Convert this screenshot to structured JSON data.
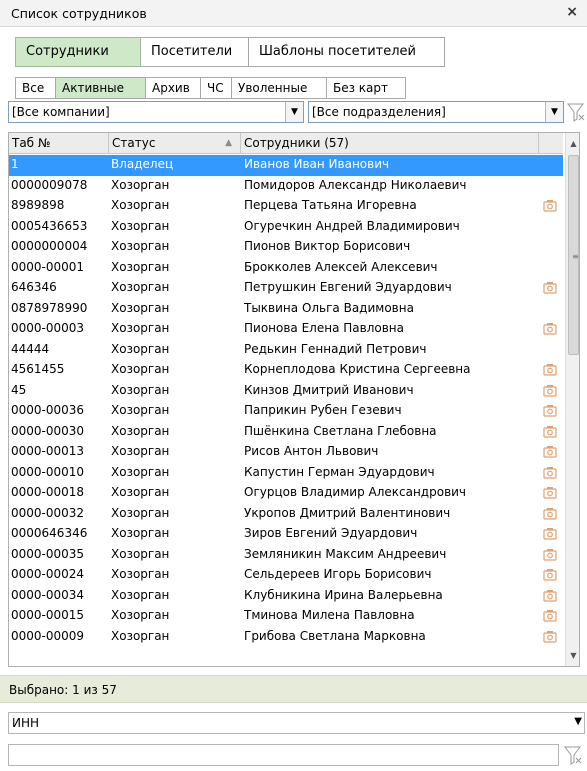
{
  "window": {
    "title": "Список сотрудников",
    "close": "×"
  },
  "tabs_main": [
    {
      "label": "Сотрудники",
      "active": true
    },
    {
      "label": "Посетители",
      "active": false
    },
    {
      "label": "Шаблоны посетителей",
      "active": false
    }
  ],
  "tabs_filter": [
    {
      "label": "Все",
      "active": false
    },
    {
      "label": "Активные",
      "active": true
    },
    {
      "label": "Архив",
      "active": false
    },
    {
      "label": "ЧС",
      "active": false
    },
    {
      "label": "Уволенные",
      "active": false
    },
    {
      "label": "Без карт",
      "active": false
    }
  ],
  "filters": {
    "company": "[Все компании]",
    "department": "[Все подразделения]"
  },
  "grid": {
    "headers": {
      "tab": "Таб №",
      "status": "Статус",
      "employees": "Сотрудники (57)"
    },
    "rows": [
      {
        "tab": "1",
        "status": "Владелец",
        "name": "Иванов Иван Иванович",
        "photo": false,
        "selected": true
      },
      {
        "tab": "0000009078",
        "status": "Хозорган",
        "name": "Помидоров Александр Николаевич",
        "photo": false,
        "selected": false
      },
      {
        "tab": "8989898",
        "status": "Хозорган",
        "name": "Перцева Татьяна Игоревна",
        "photo": true,
        "selected": false
      },
      {
        "tab": "0005436653",
        "status": "Хозорган",
        "name": "Огуречкин Андрей Владимирович",
        "photo": false,
        "selected": false
      },
      {
        "tab": "0000000004",
        "status": "Хозорган",
        "name": "Пионов Виктор Борисович",
        "photo": false,
        "selected": false
      },
      {
        "tab": "0000-00001",
        "status": "Хозорган",
        "name": "Брокколев Алексей Алексевич",
        "photo": false,
        "selected": false
      },
      {
        "tab": "646346",
        "status": "Хозорган",
        "name": "Петрушкин Евгений Эдуардович",
        "photo": true,
        "selected": false
      },
      {
        "tab": "0878978990",
        "status": "Хозорган",
        "name": "Тыквина Ольга Вадимовна",
        "photo": false,
        "selected": false
      },
      {
        "tab": "0000-00003",
        "status": "Хозорган",
        "name": "Пионова Елена Павловна",
        "photo": true,
        "selected": false
      },
      {
        "tab": "44444",
        "status": "Хозорган",
        "name": "Редькин Геннадий Петрович",
        "photo": false,
        "selected": false
      },
      {
        "tab": "4561455",
        "status": "Хозорган",
        "name": "Корнеплодова Кристина Сергеевна",
        "photo": true,
        "selected": false
      },
      {
        "tab": "45",
        "status": "Хозорган",
        "name": "Кинзов Дмитрий Иванович",
        "photo": true,
        "selected": false
      },
      {
        "tab": "0000-00036",
        "status": "Хозорган",
        "name": "Паприкин Рубен Гезевич",
        "photo": true,
        "selected": false
      },
      {
        "tab": "0000-00030",
        "status": "Хозорган",
        "name": "Пшёнкина Светлана Глебовна",
        "photo": true,
        "selected": false
      },
      {
        "tab": "0000-00013",
        "status": "Хозорган",
        "name": "Рисов Антон Львович",
        "photo": true,
        "selected": false
      },
      {
        "tab": "0000-00010",
        "status": "Хозорган",
        "name": "Капустин Герман Эдуардович",
        "photo": true,
        "selected": false
      },
      {
        "tab": "0000-00018",
        "status": "Хозорган",
        "name": "Огурцов Владимир Александрович",
        "photo": true,
        "selected": false
      },
      {
        "tab": "0000-00032",
        "status": "Хозорган",
        "name": "Укропов Дмитрий Валентинович",
        "photo": true,
        "selected": false
      },
      {
        "tab": "0000646346",
        "status": "Хозорган",
        "name": "Зиров Евгений Эдуардович",
        "photo": true,
        "selected": false
      },
      {
        "tab": "0000-00035",
        "status": "Хозорган",
        "name": "Земляникин Максим Андреевич",
        "photo": true,
        "selected": false
      },
      {
        "tab": "0000-00024",
        "status": "Хозорган",
        "name": "Сельдереев Игорь Борисович",
        "photo": true,
        "selected": false
      },
      {
        "tab": "0000-00034",
        "status": "Хозорган",
        "name": "Клубникина Ирина Валерьевна",
        "photo": true,
        "selected": false
      },
      {
        "tab": "0000-00015",
        "status": "Хозорган",
        "name": "Тминова Милена Павловна",
        "photo": true,
        "selected": false
      },
      {
        "tab": "0000-00009",
        "status": "Хозорган",
        "name": "Грибова Светлана Марковна",
        "photo": true,
        "selected": false
      }
    ]
  },
  "status_bar": {
    "text": "Выбрано: 1 из 57"
  },
  "search": {
    "field": "ИНН",
    "value": ""
  },
  "colors": {
    "selection": "#3399ff",
    "tab_active": "#cfe8c8",
    "photo_icon": "#e0a070",
    "status_bar": "#e6ecd9"
  },
  "icons": {
    "photo": "camera-icon",
    "filter": "filter-clear-icon",
    "dropdown": "chevron-down-icon"
  }
}
